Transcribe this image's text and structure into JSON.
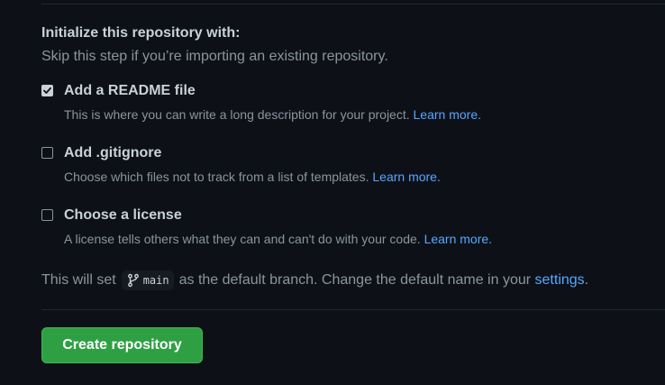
{
  "init": {
    "title": "Initialize this repository with:",
    "subtitle": "Skip this step if you’re importing an existing repository."
  },
  "options": [
    {
      "label": "Add a README file",
      "checked": true,
      "description": "This is where you can write a long description for your project.",
      "link": "Learn more."
    },
    {
      "label": "Add .gitignore",
      "checked": false,
      "description": "Choose which files not to track from a list of templates.",
      "link": "Learn more."
    },
    {
      "label": "Choose a license",
      "checked": false,
      "description": "A license tells others what they can and can't do with your code.",
      "link": "Learn more."
    }
  ],
  "branch": {
    "prefix": "This will set",
    "name": "main",
    "middle": "as the default branch. Change the default name in your",
    "settings_link": "settings",
    "suffix": "."
  },
  "create_button": {
    "label": "Create repository"
  },
  "icons": {
    "check": "check-icon",
    "branch": "git-branch-icon"
  },
  "colors": {
    "background": "#0d1117",
    "text": "#c9d1d9",
    "muted": "#8b949e",
    "link": "#58a6ff",
    "button": "#2ea043"
  }
}
